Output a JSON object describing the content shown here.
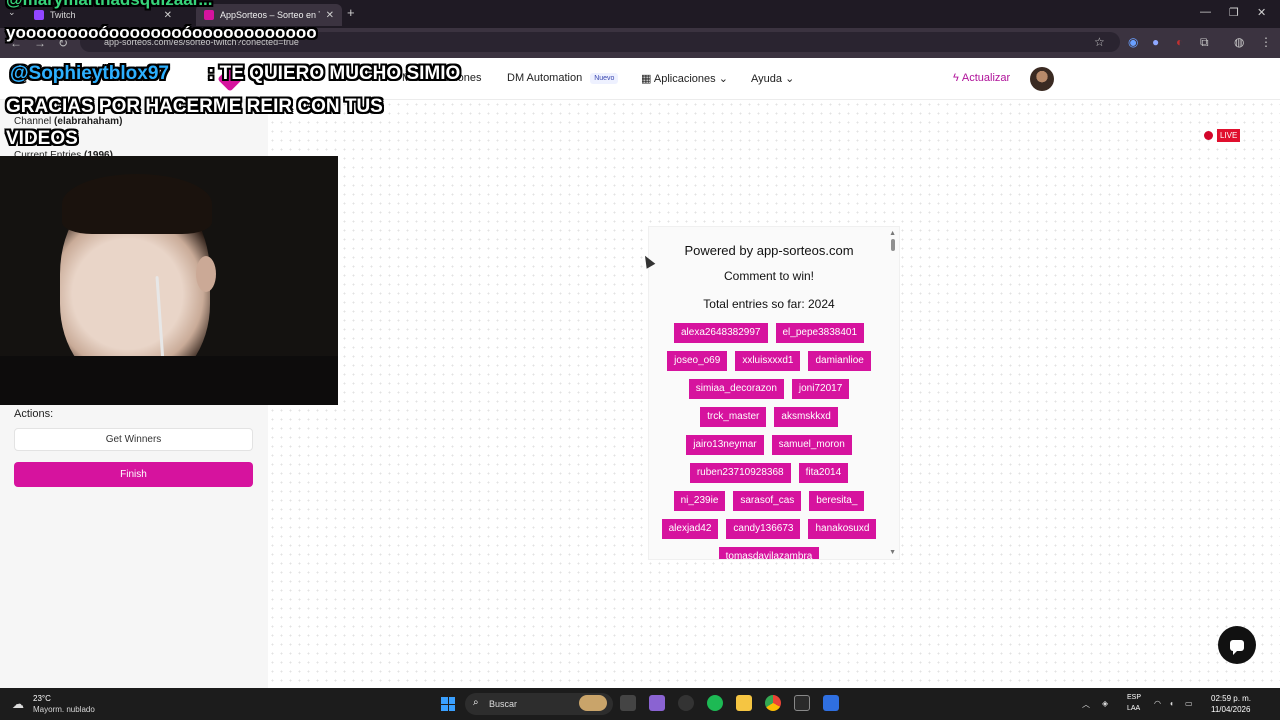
{
  "browser": {
    "tabs": [
      {
        "label": "Twitch"
      },
      {
        "label": "AppSorteos – Sorteo en Twitch"
      }
    ],
    "url": "app-sorteos.com/es/sorteo-twitch?conected=true"
  },
  "header": {
    "nav": [
      {
        "label": "Mis Selecciones"
      },
      {
        "label": "DM Automation",
        "badge": "Nuevo"
      },
      {
        "label": "Aplicaciones"
      },
      {
        "label": "Ayuda"
      }
    ],
    "upgrade_label": "Actualizar"
  },
  "sidebar": {
    "channel_label": "Channel",
    "channel_value": "(elabrahaham)",
    "entries_label": "Current Entries",
    "entries_value": "(1996)",
    "actions_label": "Actions:",
    "get_winners_label": "Get Winners",
    "finish_label": "Finish"
  },
  "live_label": "LIVE",
  "widget": {
    "powered": "Powered by app-sorteos.com",
    "comment": "Comment to win!",
    "total": "Total entries so far: 2024",
    "entries": [
      "alexa2648382997",
      "el_pepe3838401",
      "joseo_o69",
      "xxluisxxxd1",
      "damianlioe",
      "simiaa_decorazon",
      "joni72017",
      "trck_master",
      "aksmskkxd",
      "jairo13neymar",
      "samuel_moron",
      "ruben23710928368",
      "fita2014",
      "ni_239ie",
      "sarasof_cas",
      "beresita_",
      "alexjad42",
      "candy136673",
      "hanakosuxd",
      "tomasdavilazambra"
    ]
  },
  "overlay": {
    "top": "@marymarthadsquizaar...",
    "yooo": "yooooooooóoooooooóoooooooooooo",
    "user": "@Sophieytblox97",
    "msg1": ": TE QUIERO MUCHO SIMIO",
    "msg2": "GRACIAS POR HACERME REIR CON TUS",
    "msg3": "VIDEOS"
  },
  "taskbar": {
    "temp": "23°C",
    "weather": "Mayorm. nublado",
    "search": "Buscar",
    "lang1": "ESP",
    "lang2": "LAA",
    "time": "02:59 p. m.",
    "date": "11/04/2026"
  },
  "colors": {
    "brand": "#d6139e",
    "live": "#e0102e"
  }
}
